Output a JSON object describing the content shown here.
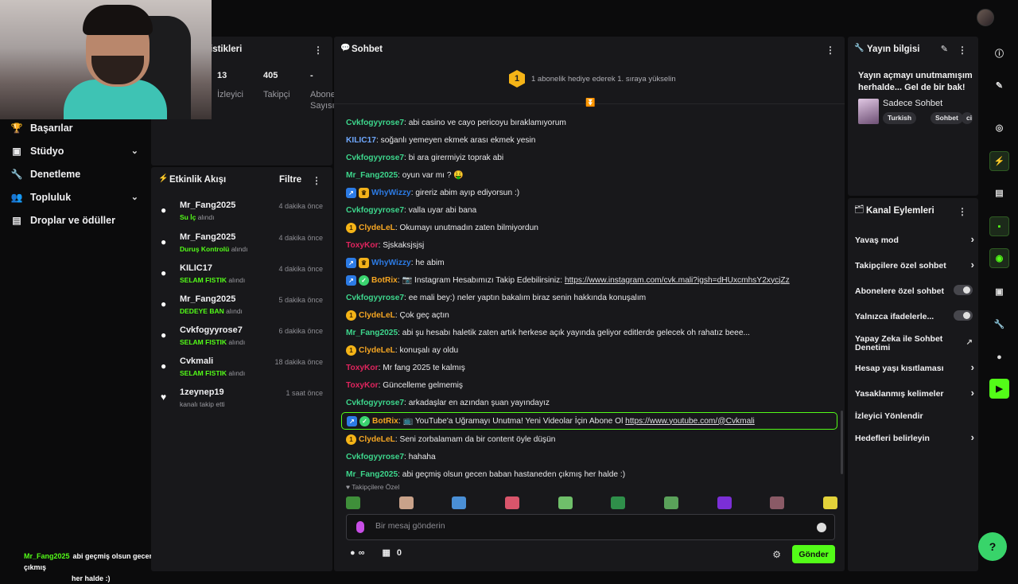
{
  "left_nav": [
    {
      "label": "Başarılar",
      "icon": "trophy-icon",
      "expandable": false
    },
    {
      "label": "Stüdyo",
      "icon": "studio-icon",
      "expandable": true
    },
    {
      "label": "Denetleme",
      "icon": "wrench-icon",
      "expandable": false
    },
    {
      "label": "Topluluk",
      "icon": "community-icon",
      "expandable": true
    },
    {
      "label": "Droplar ve ödüller",
      "icon": "drops-icon",
      "expandable": false
    }
  ],
  "overlay_chat": {
    "user": "Mr_Fang2025",
    "line1": "abi geçmiş olsun gecen baban hastaneden çıkmış",
    "line2": "her halde :)"
  },
  "stats": {
    "title": "istikleri",
    "viewers": {
      "value": "13",
      "label": "İzleyici"
    },
    "followers": {
      "value": "405",
      "label": "Takipçi"
    },
    "subs": {
      "value": "-",
      "label1": "Abone",
      "label2": "Sayısı"
    }
  },
  "activity": {
    "title": "Etkinlik Akışı",
    "filter": "Filtre",
    "items": [
      {
        "name": "Mr_Fang2025",
        "reward": "Su İç",
        "suffix": "alındı",
        "time": "4 dakika önce"
      },
      {
        "name": "Mr_Fang2025",
        "reward": "Duruş Kontrolü",
        "suffix": "alındı",
        "time": "4 dakika önce"
      },
      {
        "name": "KILIC17",
        "reward": "SELAM FISTIK",
        "suffix": "alındı",
        "time": "4 dakika önce"
      },
      {
        "name": "Mr_Fang2025",
        "reward": "DEDEYE BAN",
        "suffix": "alındı",
        "time": "5 dakika önce"
      },
      {
        "name": "Cvkfogyyrose7",
        "reward": "SELAM FISTIK",
        "suffix": "alındı",
        "time": "6 dakika önce"
      },
      {
        "name": "Cvkmali",
        "reward": "SELAM FISTIK",
        "suffix": "alındı",
        "time": "18 dakika önce"
      },
      {
        "name": "1zeynep19",
        "reward": "",
        "suffix": "kanalı takip etti",
        "time": "1 saat önce"
      }
    ]
  },
  "chat": {
    "title": "Sohbet",
    "pinned": "1 abonelik hediye ederek 1. sıraya yükselin",
    "pinned_badge": "1",
    "messages": [
      {
        "user": "Cvkfogyyrose7",
        "color": "#3dd68c",
        "badges": [],
        "text": ": abi casino ve cayo pericoyu bıraklamıyorum"
      },
      {
        "user": "KILIC17",
        "color": "#6fa8ff",
        "badges": [],
        "text": ": soğanlı yemeyen ekmek arası ekmek yesin"
      },
      {
        "user": "Cvkfogyyrose7",
        "color": "#3dd68c",
        "badges": [],
        "text": ": bi ara girermiyiz toprak abi"
      },
      {
        "user": "Mr_Fang2025",
        "color": "#3dd68c",
        "badges": [],
        "text": ": oyun var mı ? 🤑"
      },
      {
        "user": "WhyWizzy",
        "color": "#2c7be5",
        "badges": [
          "blue",
          "crown"
        ],
        "text": ": gireriz abim ayıp ediyorsun :)"
      },
      {
        "user": "Cvkfogyyrose7",
        "color": "#3dd68c",
        "badges": [],
        "text": ": valla uyar abi bana"
      },
      {
        "user": "ClydeLeL",
        "color": "#f5a623",
        "badges": [
          "one"
        ],
        "text": ": Okumayı unutmadın zaten bilmiyordun"
      },
      {
        "user": "ToxyKor",
        "color": "#e0245e",
        "badges": [],
        "text": ": Sjskaksjsjsj"
      },
      {
        "user": "WhyWizzy",
        "color": "#2c7be5",
        "badges": [
          "blue",
          "crown"
        ],
        "text": ": he abim"
      },
      {
        "user": "BotRix",
        "color": "#f5a623",
        "badges": [
          "blue",
          "green"
        ],
        "text": ": 📷 Instagram Hesabımızı Takip Edebilirsiniz: ",
        "link": "https://www.instagram.com/cvk.mali?igsh=dHUxcmhsY2xycjZz"
      },
      {
        "user": "Cvkfogyyrose7",
        "color": "#3dd68c",
        "badges": [],
        "text": ": ee mali bey:) neler yaptın bakalım biraz senin hakkında konuşalım"
      },
      {
        "user": "ClydeLeL",
        "color": "#f5a623",
        "badges": [
          "one"
        ],
        "text": ": Çok geç açtın"
      },
      {
        "user": "Mr_Fang2025",
        "color": "#3dd68c",
        "badges": [],
        "text": ": abi şu hesabı haletik zaten artık herkese açık yayında geliyor editlerde gelecek oh rahatız beee..."
      },
      {
        "user": "ClydeLeL",
        "color": "#f5a623",
        "badges": [
          "one"
        ],
        "text": ": konuşalı ay oldu"
      },
      {
        "user": "ToxyKor",
        "color": "#e0245e",
        "badges": [],
        "text": ": Mr fang 2025 te kalmış"
      },
      {
        "user": "ToxyKor",
        "color": "#e0245e",
        "badges": [],
        "text": ": Güncelleme gelmemiş"
      },
      {
        "user": "Cvkfogyyrose7",
        "color": "#3dd68c",
        "badges": [],
        "text": ": arkadaşlar en azından şuan yayındayız"
      },
      {
        "user": "BotRix",
        "color": "#f5a623",
        "badges": [
          "blue",
          "green"
        ],
        "text": ": 📺 YouTube'a Uğramayı Unutma! Yeni Videolar İçin Abone Ol ",
        "link": "https://www.youtube.com/@Cvkmali",
        "highlight": true
      },
      {
        "user": "ClydeLeL",
        "color": "#f5a623",
        "badges": [
          "one"
        ],
        "text": ": Seni zorbalamam da bir content öyle düşün"
      },
      {
        "user": "Cvkfogyyrose7",
        "color": "#3dd68c",
        "badges": [],
        "text": ": hahaha"
      },
      {
        "user": "Mr_Fang2025",
        "color": "#3dd68c",
        "badges": [],
        "text": ": abi geçmiş olsun gecen baban hastaneden çıkmış her halde :)"
      }
    ],
    "followers_only_label": "Takipçilere Özel",
    "emote_colors": [
      "#3f8f3a",
      "#c9a28a",
      "#4a8fd6",
      "#d9556b",
      "#6fbf6a",
      "#2f8f4a",
      "#5aa15a",
      "#7b2fd6",
      "#8a5a66",
      "#e3d23a"
    ],
    "input_placeholder": "Bir mesaj gönderin",
    "infinity_label": "∞",
    "store_count": "0",
    "send_label": "Gönder"
  },
  "stream_info": {
    "title": "Yayın bilgisi",
    "description": "Yayın açmayı unutmamışım herhalde... Gel de bir bak!",
    "category": "Sadece Sohbet",
    "tags": [
      "Turkish",
      "Sohbet",
      "ci"
    ]
  },
  "channel_actions": {
    "title": "Kanal Eylemleri",
    "items": [
      {
        "label": "Yavaş mod",
        "control": "chevron"
      },
      {
        "label": "Takipçilere özel sohbet",
        "control": "chevron"
      },
      {
        "label": "Abonelere özel sohbet",
        "control": "toggle"
      },
      {
        "label": "Yalnızca ifadelerle...",
        "control": "toggle"
      },
      {
        "label": "Yapay Zeka ile Sohbet Denetimi",
        "control": "external"
      },
      {
        "label": "Hesap yaşı kısıtlaması",
        "control": "chevron"
      },
      {
        "label": "Yasaklanmış kelimeler",
        "control": "chevron"
      },
      {
        "label": "İzleyici Yönlendir",
        "control": "none"
      },
      {
        "label": "Hedefleri belirleyin",
        "control": "chevron"
      }
    ]
  },
  "accent": "#53fc18"
}
